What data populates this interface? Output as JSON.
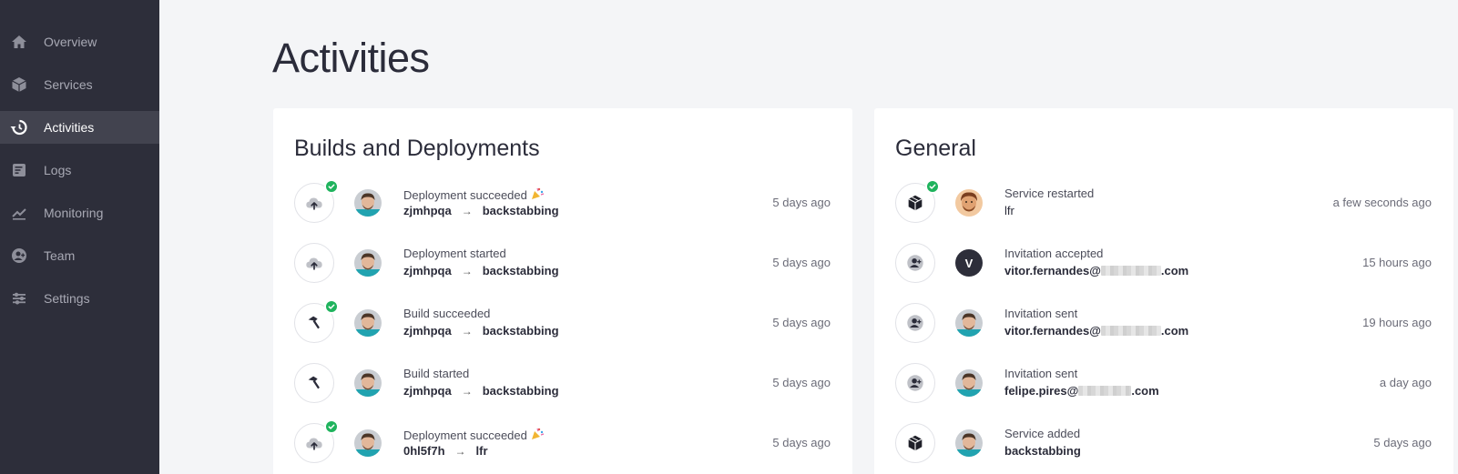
{
  "sidebar": {
    "items": [
      {
        "label": "Overview",
        "icon": "home-icon"
      },
      {
        "label": "Services",
        "icon": "cube-icon"
      },
      {
        "label": "Activities",
        "icon": "history-icon",
        "active": true
      },
      {
        "label": "Logs",
        "icon": "logs-icon"
      },
      {
        "label": "Monitoring",
        "icon": "chart-icon"
      },
      {
        "label": "Team",
        "icon": "team-icon"
      },
      {
        "label": "Settings",
        "icon": "settings-icon"
      }
    ]
  },
  "page": {
    "title": "Activities"
  },
  "builds": {
    "title": "Builds and Deployments",
    "rows": [
      {
        "icon": "cloud-upload-icon",
        "status": "success",
        "title": "Deployment succeeded",
        "from": "zjmhpqa",
        "to": "backstabbing",
        "time": "5 days ago"
      },
      {
        "icon": "cloud-upload-icon",
        "status": "",
        "title": "Deployment started",
        "from": "zjmhpqa",
        "to": "backstabbing",
        "time": "5 days ago"
      },
      {
        "icon": "hammer-icon",
        "status": "success",
        "title": "Build succeeded",
        "from": "zjmhpqa",
        "to": "backstabbing",
        "time": "5 days ago"
      },
      {
        "icon": "hammer-icon",
        "status": "",
        "title": "Build started",
        "from": "zjmhpqa",
        "to": "backstabbing",
        "time": "5 days ago"
      },
      {
        "icon": "cloud-upload-icon",
        "status": "success",
        "title": "Deployment succeeded",
        "from": "0hl5f7h",
        "to": "lfr",
        "time": "5 days ago"
      }
    ],
    "arrow": "→"
  },
  "general": {
    "title": "General",
    "rows": [
      {
        "icon": "cube-icon",
        "status": "success",
        "title": "Service restarted",
        "sub": "lfr",
        "time": "a few seconds ago"
      },
      {
        "icon": "user-add-icon",
        "status": "",
        "title": "Invitation accepted",
        "sub_prefix": "vitor.fernandes@",
        "sub_suffix": ".com",
        "avatar_letter": "V",
        "time": "15 hours ago"
      },
      {
        "icon": "user-add-icon",
        "status": "",
        "title": "Invitation sent",
        "sub_prefix": "vitor.fernandes@",
        "sub_suffix": ".com",
        "time": "19 hours ago"
      },
      {
        "icon": "user-add-icon",
        "status": "",
        "title": "Invitation sent",
        "sub_prefix": "felipe.pires@",
        "sub_suffix": ".com",
        "time": "a day ago"
      },
      {
        "icon": "cube-icon",
        "status": "",
        "title": "Service added",
        "sub": "backstabbing",
        "time": "5 days ago"
      }
    ]
  },
  "colors": {
    "sidebar_bg": "#2d2e3a",
    "active_bg": "#42434f",
    "success": "#1fb35d",
    "page_bg": "#f4f5f7"
  }
}
